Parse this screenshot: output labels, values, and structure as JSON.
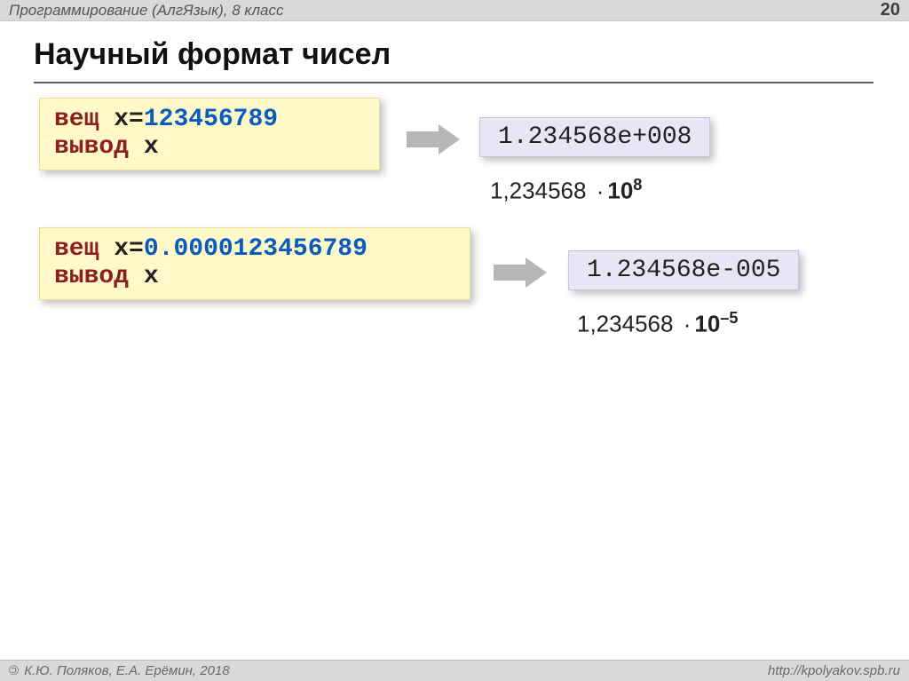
{
  "header": {
    "breadcrumb": "Программирование (АлгЯзык), 8 класс",
    "page_number": "20"
  },
  "title": "Научный формат чисел",
  "example1": {
    "keyword_type": "вещ",
    "var": "x",
    "eq": "=",
    "value": "123456789",
    "output_keyword": "вывод",
    "output_var": "x",
    "result": "1.234568e+008",
    "math_mantissa": "1,234568",
    "math_dot": "·",
    "math_base": "10",
    "math_exp": "8"
  },
  "example2": {
    "keyword_type": "вещ",
    "var": "x",
    "eq": "=",
    "value": "0.0000123456789",
    "output_keyword": "вывод",
    "output_var": "x",
    "result": "1.234568e-005",
    "math_mantissa": "1,234568",
    "math_dot": "·",
    "math_base": "10",
    "math_exp": "–5"
  },
  "footer": {
    "copyright": " К.Ю. Поляков, Е.А. Ерёмин, 2018",
    "url": "http://kpolyakov.spb.ru"
  }
}
